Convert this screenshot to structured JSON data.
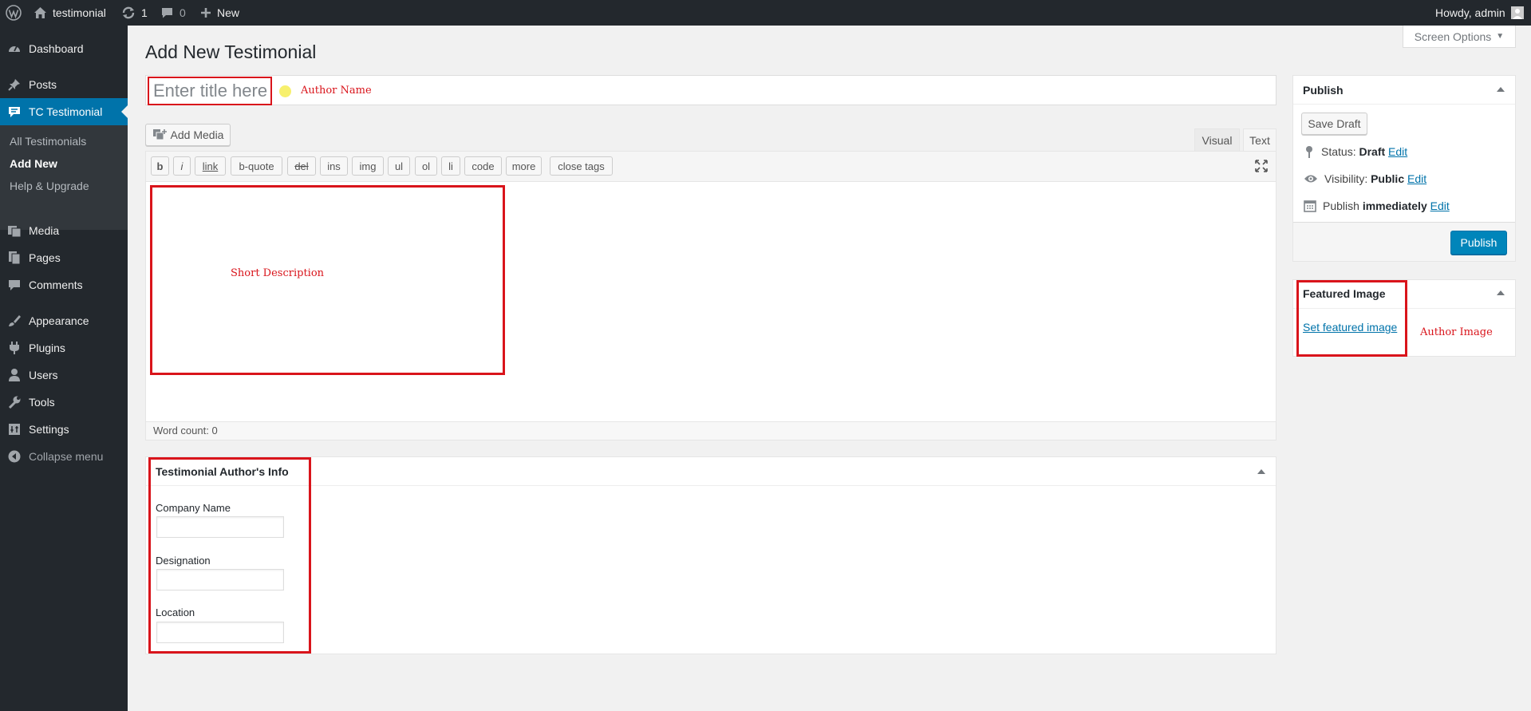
{
  "adminbar": {
    "site_name": "testimonial",
    "updates_count": "1",
    "comments_count": "0",
    "new_label": "New",
    "howdy": "Howdy, admin"
  },
  "sidebar": {
    "items": [
      {
        "label": "Dashboard",
        "icon": "dashboard-icon"
      },
      {
        "label": "Posts",
        "icon": "pin-icon"
      },
      {
        "label": "TC Testimonial",
        "icon": "comment-icon"
      },
      {
        "label": "Media",
        "icon": "media-icon"
      },
      {
        "label": "Pages",
        "icon": "pages-icon"
      },
      {
        "label": "Comments",
        "icon": "comments-icon"
      },
      {
        "label": "Appearance",
        "icon": "brush-icon"
      },
      {
        "label": "Plugins",
        "icon": "plugin-icon"
      },
      {
        "label": "Users",
        "icon": "user-icon"
      },
      {
        "label": "Tools",
        "icon": "wrench-icon"
      },
      {
        "label": "Settings",
        "icon": "settings-icon"
      }
    ],
    "submenu": [
      "All Testimonials",
      "Add New",
      "Help & Upgrade"
    ],
    "collapse": "Collapse menu"
  },
  "main": {
    "page_title": "Add New Testimonial",
    "screen_options": "Screen Options",
    "title_placeholder": "Enter title here",
    "author_name_note": "Author Name",
    "add_media": "Add Media",
    "tab_visual": "Visual",
    "tab_text": "Text",
    "quicktags": [
      "b",
      "i",
      "link",
      "b-quote",
      "del",
      "ins",
      "img",
      "ul",
      "ol",
      "li",
      "code",
      "more",
      "close tags"
    ],
    "short_description_note": "Short Description",
    "word_count": "Word count: 0"
  },
  "author_info": {
    "title": "Testimonial Author's Info",
    "fields": [
      "Company Name",
      "Designation",
      "Location"
    ]
  },
  "publish": {
    "title": "Publish",
    "save_draft": "Save Draft",
    "status_label": "Status:",
    "status_value": "Draft",
    "visibility_label": "Visibility:",
    "visibility_value": "Public",
    "publish_label": "Publish",
    "publish_value": "immediately",
    "edit": "Edit",
    "publish_button": "Publish"
  },
  "featured": {
    "title": "Featured Image",
    "link": "Set featured image",
    "author_image_note": "Author Image"
  },
  "colors": {
    "admin_dark": "#23282d",
    "accent_blue": "#0073aa",
    "highlight_red": "#d9141b"
  }
}
